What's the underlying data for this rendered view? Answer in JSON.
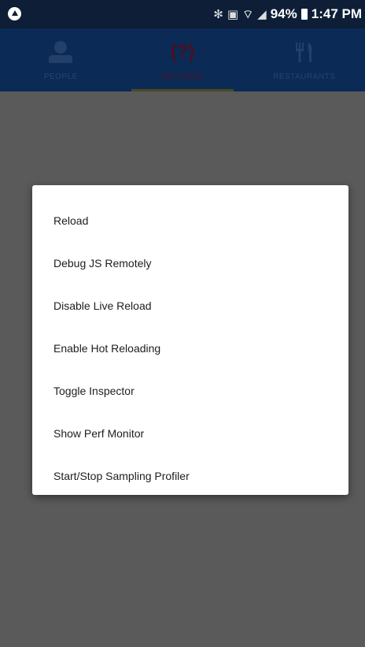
{
  "status_bar": {
    "battery_percent": "94%",
    "time": "1:47 PM",
    "icons": [
      "app-notification-icon",
      "bluetooth-icon",
      "nfc-icon",
      "wifi-icon",
      "signal-icon",
      "battery-icon"
    ]
  },
  "tabs": [
    {
      "label": "PEOPLE",
      "icon": "person-icon",
      "active": false
    },
    {
      "label": "DECISION",
      "icon": "question-icon",
      "active": true
    },
    {
      "label": "RESTAURANTS",
      "icon": "fork-knife-icon",
      "active": false
    }
  ],
  "dev_menu": {
    "items": [
      {
        "label": "Reload"
      },
      {
        "label": "Debug JS Remotely"
      },
      {
        "label": "Disable Live Reload"
      },
      {
        "label": "Enable Hot Reloading"
      },
      {
        "label": "Toggle Inspector"
      },
      {
        "label": "Show Perf Monitor"
      },
      {
        "label": "Start/Stop Sampling Profiler"
      }
    ]
  },
  "colors": {
    "status_bar": "#0d1e36",
    "tab_bar": "#0b2a56",
    "active_tab": "#4a1422",
    "overlay": "#5a5a5a",
    "dialog": "#ffffff"
  }
}
